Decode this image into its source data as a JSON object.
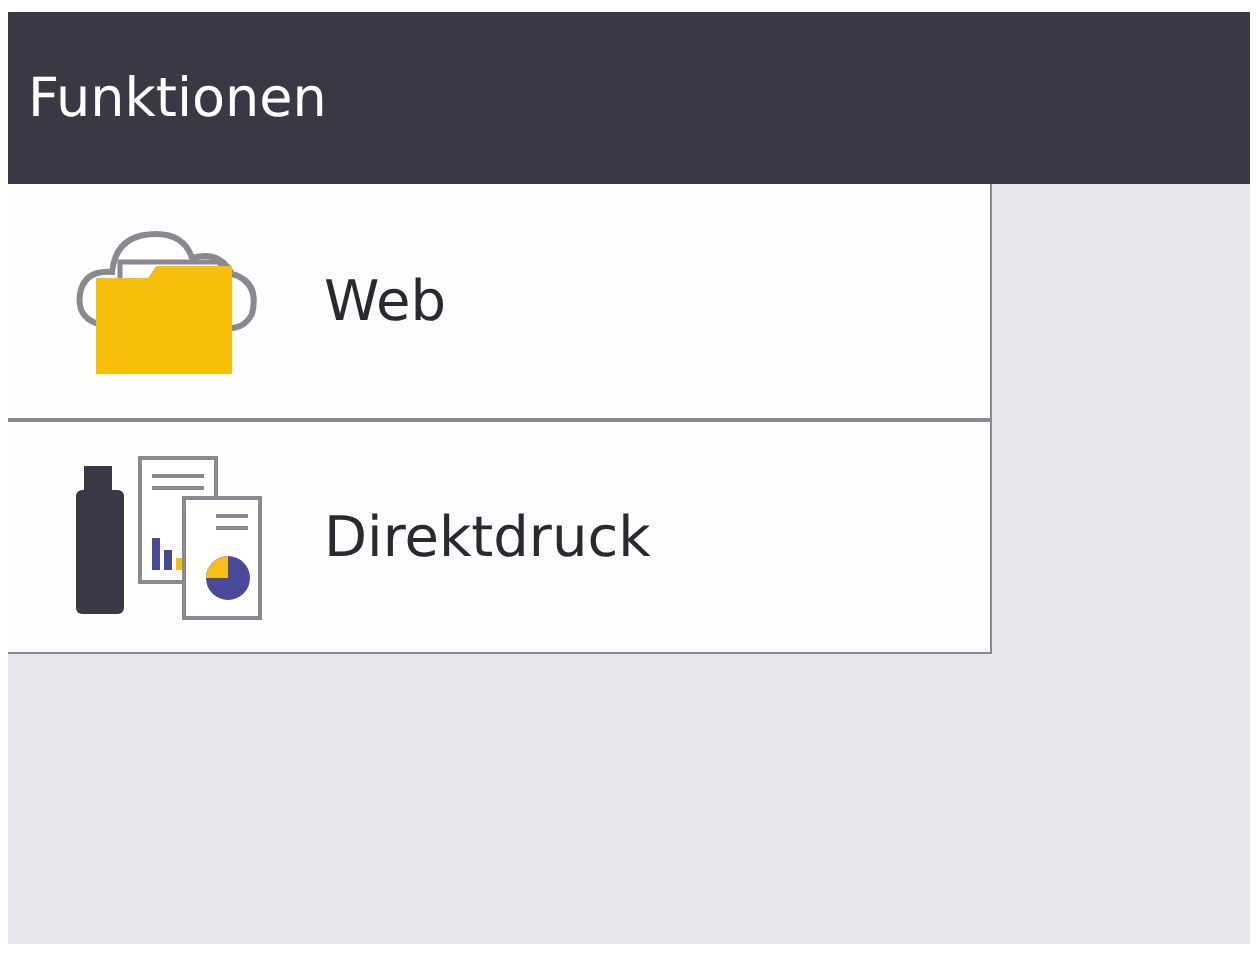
{
  "header": {
    "title": "Funktionen"
  },
  "menu": [
    {
      "kind": "web",
      "label": "Web"
    },
    {
      "kind": "direct-print",
      "label": "Direktdruck"
    }
  ]
}
